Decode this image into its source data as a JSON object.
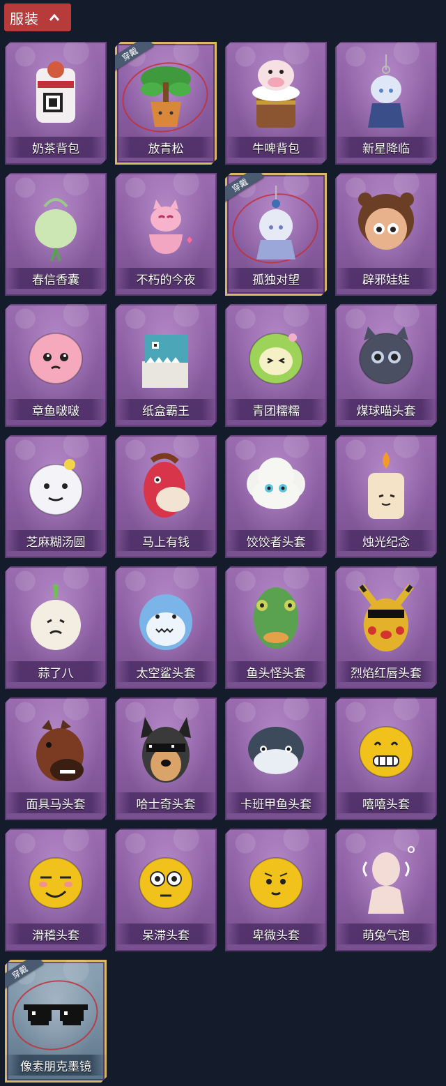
{
  "section": {
    "title": "服装"
  },
  "worn_badge": "穿戴",
  "items": [
    {
      "label": "奶茶背包",
      "icon": "milk-tea-backpack-icon",
      "worn": false
    },
    {
      "label": "放青松",
      "icon": "bonsai-pine-icon",
      "worn": true
    },
    {
      "label": "牛啤背包",
      "icon": "cow-beer-backpack-icon",
      "worn": false
    },
    {
      "label": "新星降临",
      "icon": "star-doll-keychain-icon",
      "worn": false
    },
    {
      "label": "春信香囊",
      "icon": "sachet-icon",
      "worn": false
    },
    {
      "label": "不朽的今夜",
      "icon": "fox-teacup-icon",
      "worn": false
    },
    {
      "label": "孤独对望",
      "icon": "lonely-gaze-keychain-icon",
      "worn": true
    },
    {
      "label": "辟邪娃娃",
      "icon": "doll-head-icon",
      "worn": false
    },
    {
      "label": "章鱼啵啵",
      "icon": "octopus-head-icon",
      "worn": false
    },
    {
      "label": "纸盒霸王",
      "icon": "cardboard-dino-icon",
      "worn": false
    },
    {
      "label": "青团糯糯",
      "icon": "green-rice-ball-icon",
      "worn": false
    },
    {
      "label": "煤球喵头套",
      "icon": "black-cat-head-icon",
      "worn": false
    },
    {
      "label": "芝麻糊汤圆",
      "icon": "rice-dumpling-head-icon",
      "worn": false
    },
    {
      "label": "马上有钱",
      "icon": "red-horse-head-icon",
      "worn": false
    },
    {
      "label": "饺饺者头套",
      "icon": "dumpling-cloud-head-icon",
      "worn": false
    },
    {
      "label": "烛光纪念",
      "icon": "candle-head-icon",
      "worn": false
    },
    {
      "label": "蒜了八",
      "icon": "garlic-head-icon",
      "worn": false
    },
    {
      "label": "太空鲨头套",
      "icon": "shark-head-icon",
      "worn": false
    },
    {
      "label": "鱼头怪头套",
      "icon": "fish-mask-icon",
      "worn": false
    },
    {
      "label": "烈焰红唇头套",
      "icon": "pikachu-mask-icon",
      "worn": false
    },
    {
      "label": "面具马头套",
      "icon": "horse-mask-icon",
      "worn": false
    },
    {
      "label": "哈士奇头套",
      "icon": "husky-head-icon",
      "worn": false
    },
    {
      "label": "卡班甲鱼头套",
      "icon": "carp-head-icon",
      "worn": false
    },
    {
      "label": "嘻嘻头套",
      "icon": "grin-emoji-head-icon",
      "worn": false
    },
    {
      "label": "滑稽头套",
      "icon": "funny-emoji-head-icon",
      "worn": false
    },
    {
      "label": "呆滞头套",
      "icon": "stare-emoji-head-icon",
      "worn": false
    },
    {
      "label": "卑微头套",
      "icon": "humble-emoji-head-icon",
      "worn": false
    },
    {
      "label": "萌兔气泡",
      "icon": "bunny-bubble-icon",
      "worn": false
    },
    {
      "label": "像素朋克墨镜",
      "icon": "pixel-sunglasses-icon",
      "worn": true
    }
  ],
  "colors": {
    "background": "#141b2b",
    "tab": "#b83b3c",
    "card": "#8b5ea3",
    "worn_border": "#d9b867",
    "worn_badge": "#4a5a70",
    "worn_ring": "#c2303a"
  }
}
